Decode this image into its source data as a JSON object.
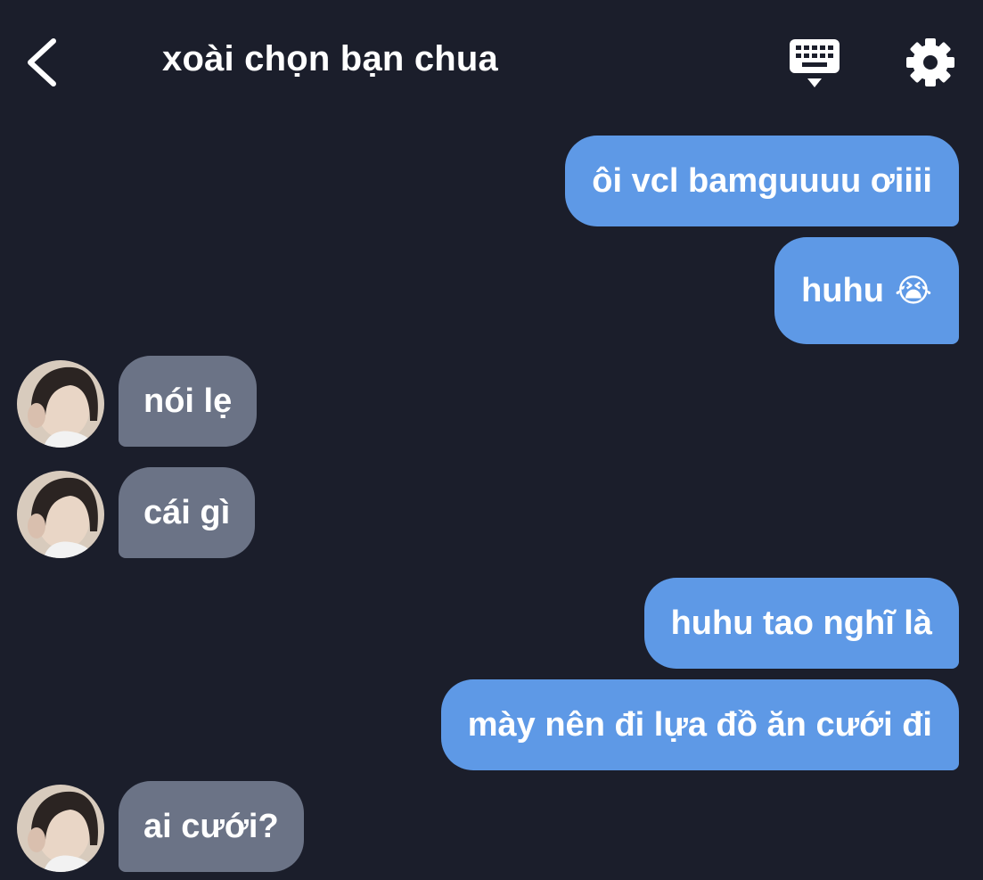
{
  "header": {
    "title": "xoài chọn bạn chua",
    "back_icon": "chevron-left-icon",
    "keyboard_icon": "keyboard-icon",
    "settings_icon": "gear-icon"
  },
  "colors": {
    "background": "#1b1e2b",
    "outgoing_bubble": "#5e99e6",
    "incoming_bubble": "#6b7386",
    "text": "#ffffff"
  },
  "messages": [
    {
      "side": "out",
      "text": "ôi vcl bamguuuu ơiiii"
    },
    {
      "side": "out",
      "text": "huhu",
      "emoji": "😭"
    },
    {
      "side": "in",
      "text": "nói lẹ",
      "avatar": "avatar"
    },
    {
      "side": "in",
      "text": "cái gì",
      "avatar": "avatar"
    },
    {
      "side": "out",
      "text": "huhu tao nghĩ là"
    },
    {
      "side": "out",
      "text": "mày nên đi lựa đồ ăn cưới đi"
    },
    {
      "side": "in",
      "text": "ai cưới?",
      "avatar": "avatar"
    }
  ]
}
